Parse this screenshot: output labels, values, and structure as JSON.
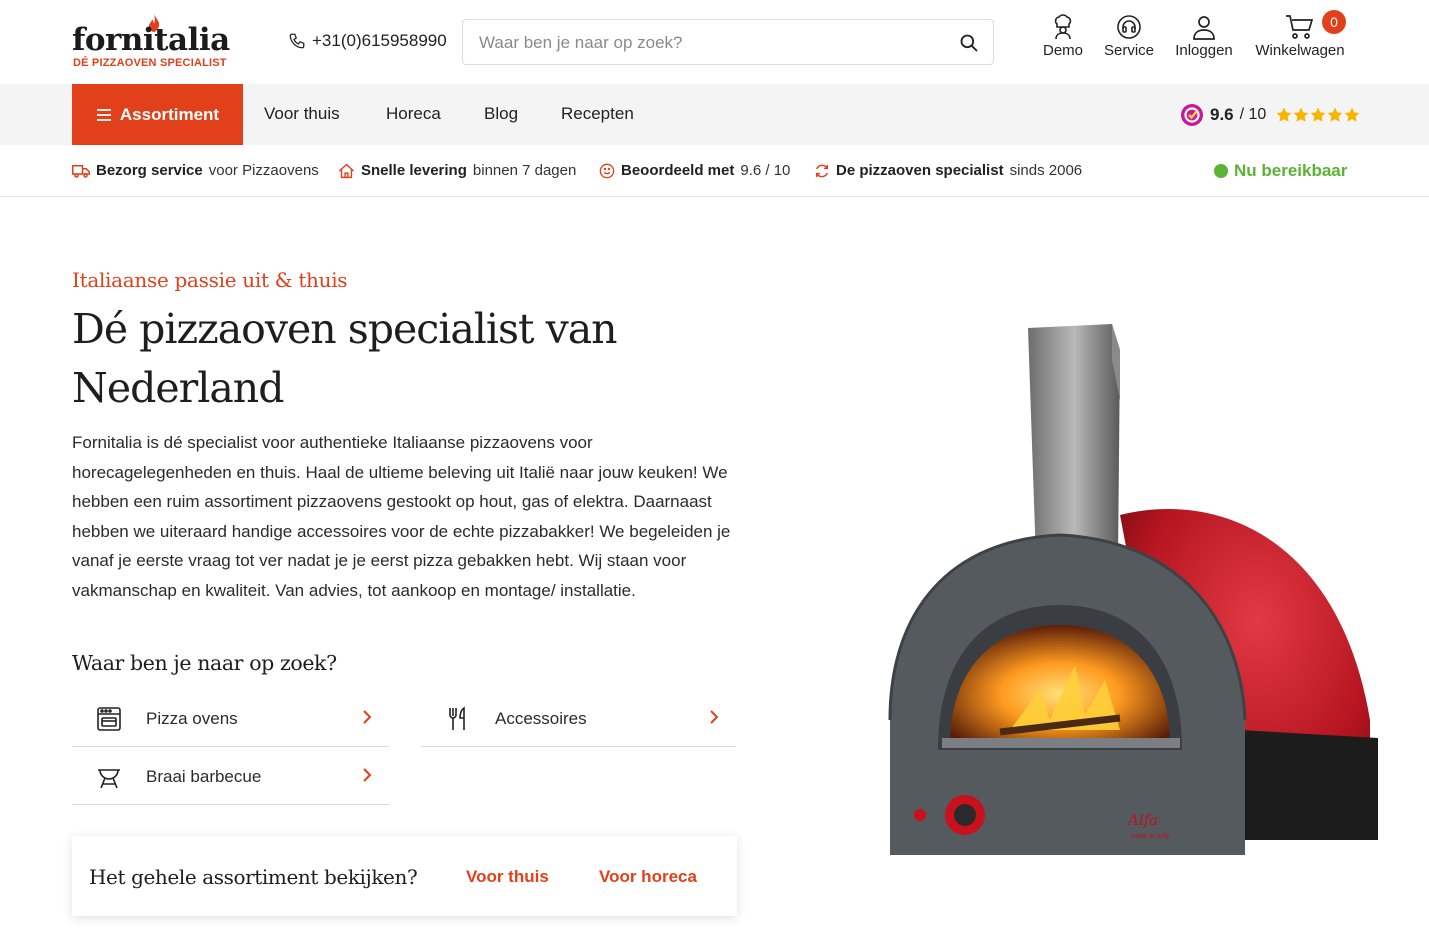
{
  "brand": {
    "logo_text": "fornitalia",
    "tagline": "DÉ PIZZAOVEN SPECIALIST",
    "accent_color": "#e1401a",
    "online_color": "#5bb333"
  },
  "header": {
    "phone": "+31(0)615958990",
    "search_placeholder": "Waar ben je naar op zoek?",
    "search_icon": "search-icon",
    "actions": [
      {
        "label": "Demo",
        "icon": "chef-icon"
      },
      {
        "label": "Service",
        "icon": "headset-icon"
      },
      {
        "label": "Inloggen",
        "icon": "user-icon"
      },
      {
        "label": "Winkelwagen",
        "icon": "cart-icon"
      }
    ],
    "cart_count": "0"
  },
  "nav": {
    "assortiment": "Assortiment",
    "links": [
      "Voor thuis",
      "Horeca",
      "Blog",
      "Recepten"
    ],
    "rating_score": "9.6",
    "rating_max": "/ 10",
    "rating_stars": 5
  },
  "usp": [
    {
      "bold": "Bezorg service",
      "rest": "voor Pizzaovens",
      "icon": "truck-icon"
    },
    {
      "bold": "Snelle levering",
      "rest": "binnen 7 dagen",
      "icon": "home-icon"
    },
    {
      "bold": "Beoordeeld met",
      "rest": "9.6 / 10",
      "icon": "smiley-icon"
    },
    {
      "bold": "De pizzaoven specialist",
      "rest": "sinds 2006",
      "icon": "refresh-icon"
    }
  ],
  "availability": "Nu bereikbaar",
  "hero": {
    "kicker": "Italiaanse passie uit & thuis",
    "title": "Dé pizzaoven specialist van Nederland",
    "intro": "Fornitalia is dé specialist voor authentieke Italiaanse pizzaovens voor horecagelegenheden en thuis. Haal de ultieme beleving uit Italië naar jouw keuken! We hebben een ruim assortiment pizzaovens gestookt op hout, gas of elektra. Daarnaast hebben we uiteraard handige accessoires voor de echte pizzabakker! We begeleiden je vanaf je eerste vraag tot ver nadat je je eerst pizza gebakken hebt. Wij staan voor vakmanschap en kwaliteit. Van advies, tot aankoop en montage/ installatie.",
    "search_heading": "Waar ben je naar op zoek?",
    "categories": [
      {
        "label": "Pizza ovens",
        "icon": "oven-icon"
      },
      {
        "label": "Accessoires",
        "icon": "cutlery-icon"
      },
      {
        "label": "Braai barbecue",
        "icon": "bbq-icon"
      }
    ]
  },
  "cta": {
    "title": "Het gehele assortiment bekijken?",
    "link_home": "Voor thuis",
    "link_horeca": "Voor horeca"
  },
  "product_image": {
    "brand_mark": "Alfa Forni style",
    "sub_mark": "made in Italy"
  }
}
